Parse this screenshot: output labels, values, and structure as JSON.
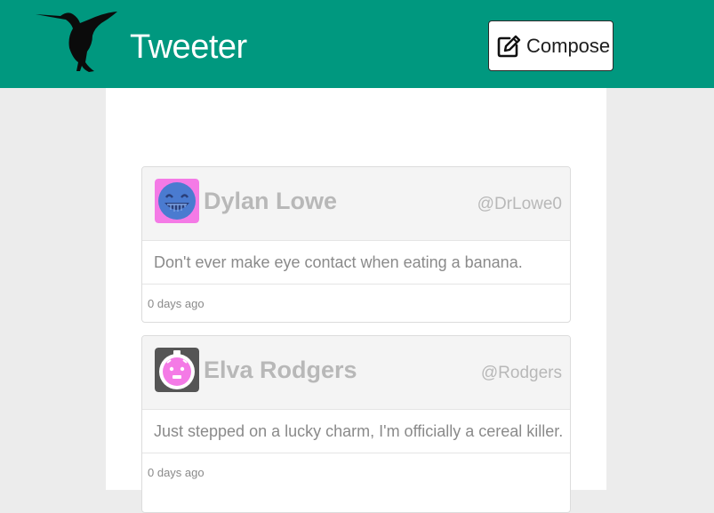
{
  "navbar": {
    "brand": "Tweeter",
    "logo_icon": "hummingbird-icon",
    "compose_label": "Compose",
    "compose_icon": "edit-icon",
    "background_color": "#00987f"
  },
  "tweets": [
    {
      "name": "Dylan Lowe",
      "handle": "@DrLowe0",
      "content": "Don't ever make eye contact when eating a banana.",
      "time": "0 days ago",
      "avatar_icon": "grinning-face-avatar-icon",
      "avatar_color": "#f47ae6"
    },
    {
      "name": "Elva Rodgers",
      "handle": "@Rodgers",
      "content": "Just stepped on a lucky charm, I'm officially a cereal killer.",
      "time": "0 days ago",
      "avatar_icon": "round-face-avatar-icon",
      "avatar_color": "#f47ae6"
    }
  ]
}
